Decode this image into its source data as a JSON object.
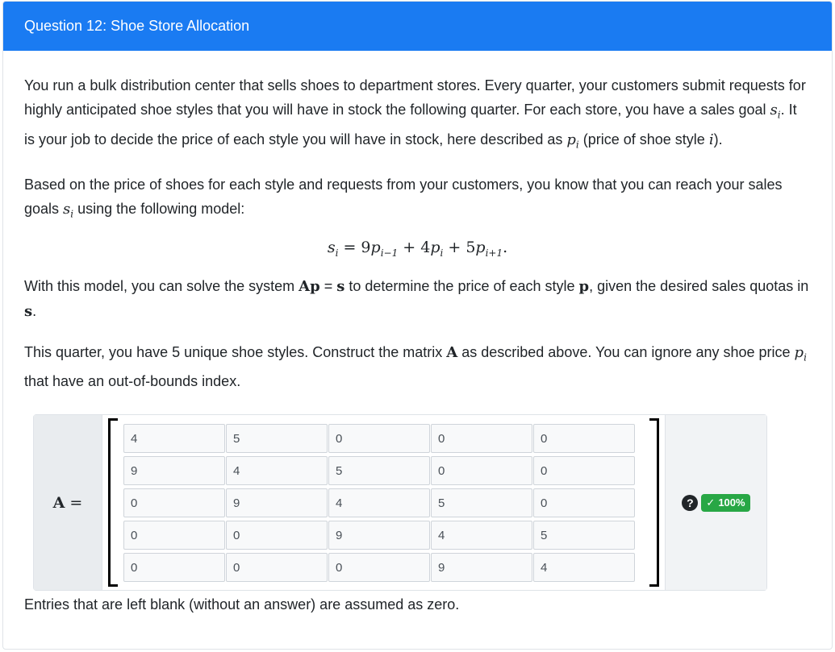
{
  "header": {
    "title": "Question 12: Shoe Store Allocation"
  },
  "para1": {
    "t1": "You run a bulk distribution center that sells shoes to department stores. Every quarter, your customers submit requests for highly anticipated shoe styles that you will have in stock the following quarter. For each store, you have a sales goal ",
    "t2": ". It is your job to decide the price of each style you will have in stock, here described as ",
    "t3": " (price of shoe style ",
    "t4": ")."
  },
  "para2": {
    "t1": "Based on the price of shoes for each style and requests from your customers, you know that you can reach your sales goals ",
    "t2": " using the following model:"
  },
  "equation": {
    "lhs": "s",
    "eqsign": " = 9",
    "term2": " + 4",
    "term3": " + 5",
    "end": "."
  },
  "para3": {
    "t1": "With this model, you can solve the system ",
    "t2": " to determine the price of each style ",
    "t3": ", given the desired sales quotas in ",
    "t4": "."
  },
  "para4": {
    "t1": "This quarter, you have 5 unique shoe styles. Construct the matrix ",
    "t2": " as described above. You can ignore any shoe price ",
    "t3": " that have an out-of-bounds index."
  },
  "matrix": {
    "label": "A",
    "eq": "=",
    "rows": [
      [
        "4",
        "5",
        "0",
        "0",
        "0"
      ],
      [
        "9",
        "4",
        "5",
        "0",
        "0"
      ],
      [
        "0",
        "9",
        "4",
        "5",
        "0"
      ],
      [
        "0",
        "0",
        "9",
        "4",
        "5"
      ],
      [
        "0",
        "0",
        "0",
        "9",
        "4"
      ]
    ]
  },
  "result": {
    "help": "?",
    "check": "✓",
    "score": "100%"
  },
  "note": "Entries that are left blank (without an answer) are assumed as zero.",
  "colors": {
    "header": "#1a7bf2",
    "badge": "#28a745"
  }
}
